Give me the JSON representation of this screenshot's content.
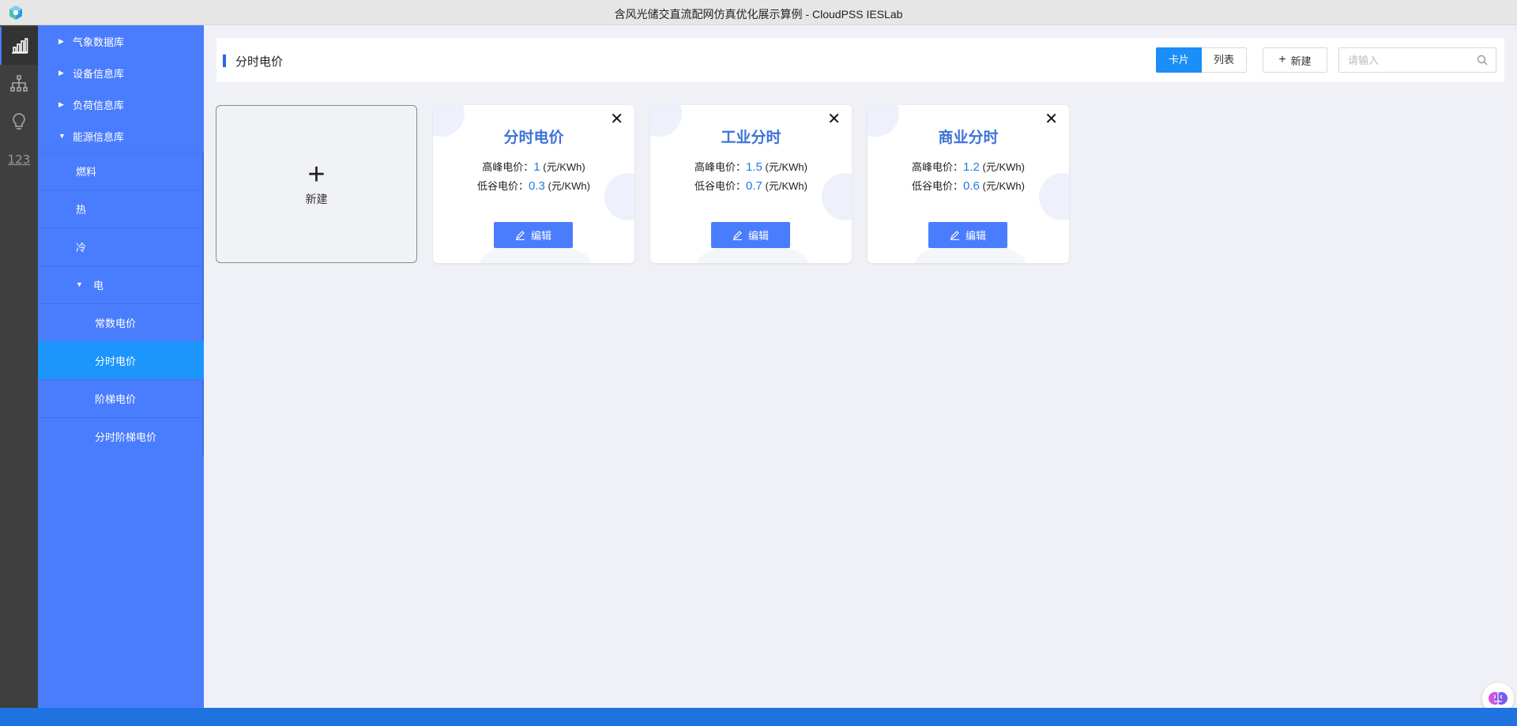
{
  "window": {
    "title": "含风光储交直流配网仿真优化展示算例 - CloudPSS IESLab"
  },
  "iconbar": {
    "number_icon": "123"
  },
  "sidebar": {
    "items": [
      {
        "label": "气象数据库",
        "expanded": false
      },
      {
        "label": "设备信息库",
        "expanded": false
      },
      {
        "label": "负荷信息库",
        "expanded": false
      },
      {
        "label": "能源信息库",
        "expanded": true
      }
    ],
    "energy_children": [
      "燃料",
      "热",
      "冷",
      "电"
    ],
    "electric_children": [
      "常数电价",
      "分时电价",
      "阶梯电价",
      "分时阶梯电价"
    ],
    "selected": "分时电价"
  },
  "header": {
    "title": "分时电价",
    "view_card_label": "卡片",
    "view_list_label": "列表",
    "new_label": "新建",
    "search_placeholder": "请输入"
  },
  "new_card": {
    "label": "新建"
  },
  "cards": [
    {
      "title": "分时电价",
      "peak_label": "高峰电价：",
      "peak_value": "1",
      "valley_label": "低谷电价：",
      "valley_value": "0.3",
      "unit": "(元/KWh)",
      "edit_label": "编辑"
    },
    {
      "title": "工业分时",
      "peak_label": "高峰电价：",
      "peak_value": "1.5",
      "valley_label": "低谷电价：",
      "valley_value": "0.7",
      "unit": "(元/KWh)",
      "edit_label": "编辑"
    },
    {
      "title": "商业分时",
      "peak_label": "高峰电价：",
      "peak_value": "1.2",
      "valley_label": "低谷电价：",
      "valley_value": "0.6",
      "unit": "(元/KWh)",
      "edit_label": "编辑"
    }
  ],
  "colors": {
    "sidebar": "#4a7dfd",
    "selected": "#1c95fc",
    "accent": "#2d63f0",
    "card_title": "#3d72d8"
  }
}
